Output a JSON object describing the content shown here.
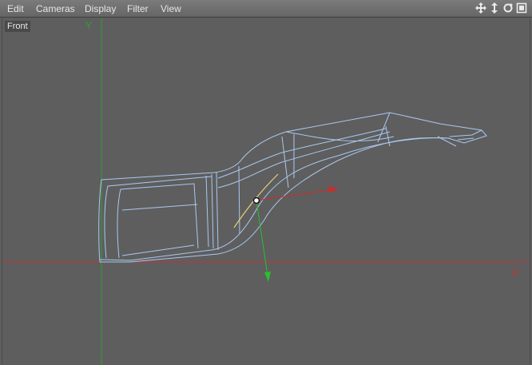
{
  "menu": {
    "items": [
      "Edit",
      "Cameras",
      "Display",
      "Filter",
      "View"
    ]
  },
  "toolbar": {
    "icons": [
      "move-view-icon",
      "zoom-view-icon",
      "rotate-view-icon",
      "maximize-view-icon"
    ]
  },
  "viewport": {
    "label": "Front",
    "axis_x_label": "X",
    "axis_y_label": "Y"
  },
  "colors": {
    "background": "#5e5e5e",
    "x_axis": "#c83232",
    "y_axis": "#2ea02e",
    "wireframe": "#a9c8f0",
    "spline": "#e8d27a"
  }
}
